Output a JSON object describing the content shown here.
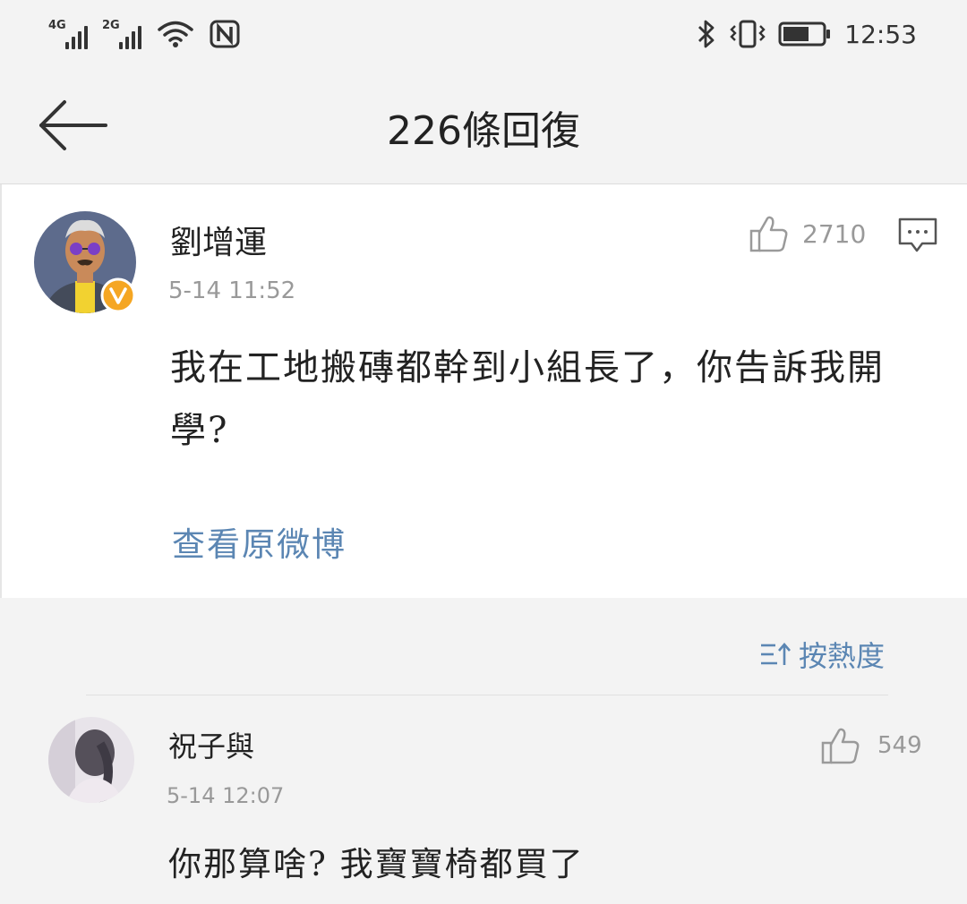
{
  "status_bar": {
    "network_1": "4G",
    "network_2": "2G",
    "time": "12:53",
    "icons": [
      "signal-icon",
      "wifi-icon",
      "nfc-icon",
      "bluetooth-icon",
      "vibrate-icon",
      "battery-icon"
    ]
  },
  "header": {
    "title": "226條回復",
    "back_icon": "back-arrow-icon"
  },
  "post": {
    "author": "劉增運",
    "verified_badge": "V",
    "time": "5-14 11:52",
    "like_count": "2710",
    "text": "我在工地搬磚都幹到小組長了，你告訴我開學?",
    "view_original": "查看原微博"
  },
  "sort": {
    "label": "按熱度",
    "icon": "sort-icon"
  },
  "reply": {
    "author": "祝子與",
    "time": "5-14 12:07",
    "like_count": "549",
    "text": "你那算啥? 我寶寶椅都買了"
  },
  "colors": {
    "link": "#5b86b3",
    "badge": "#f5a623",
    "background": "#f3f3f3"
  }
}
